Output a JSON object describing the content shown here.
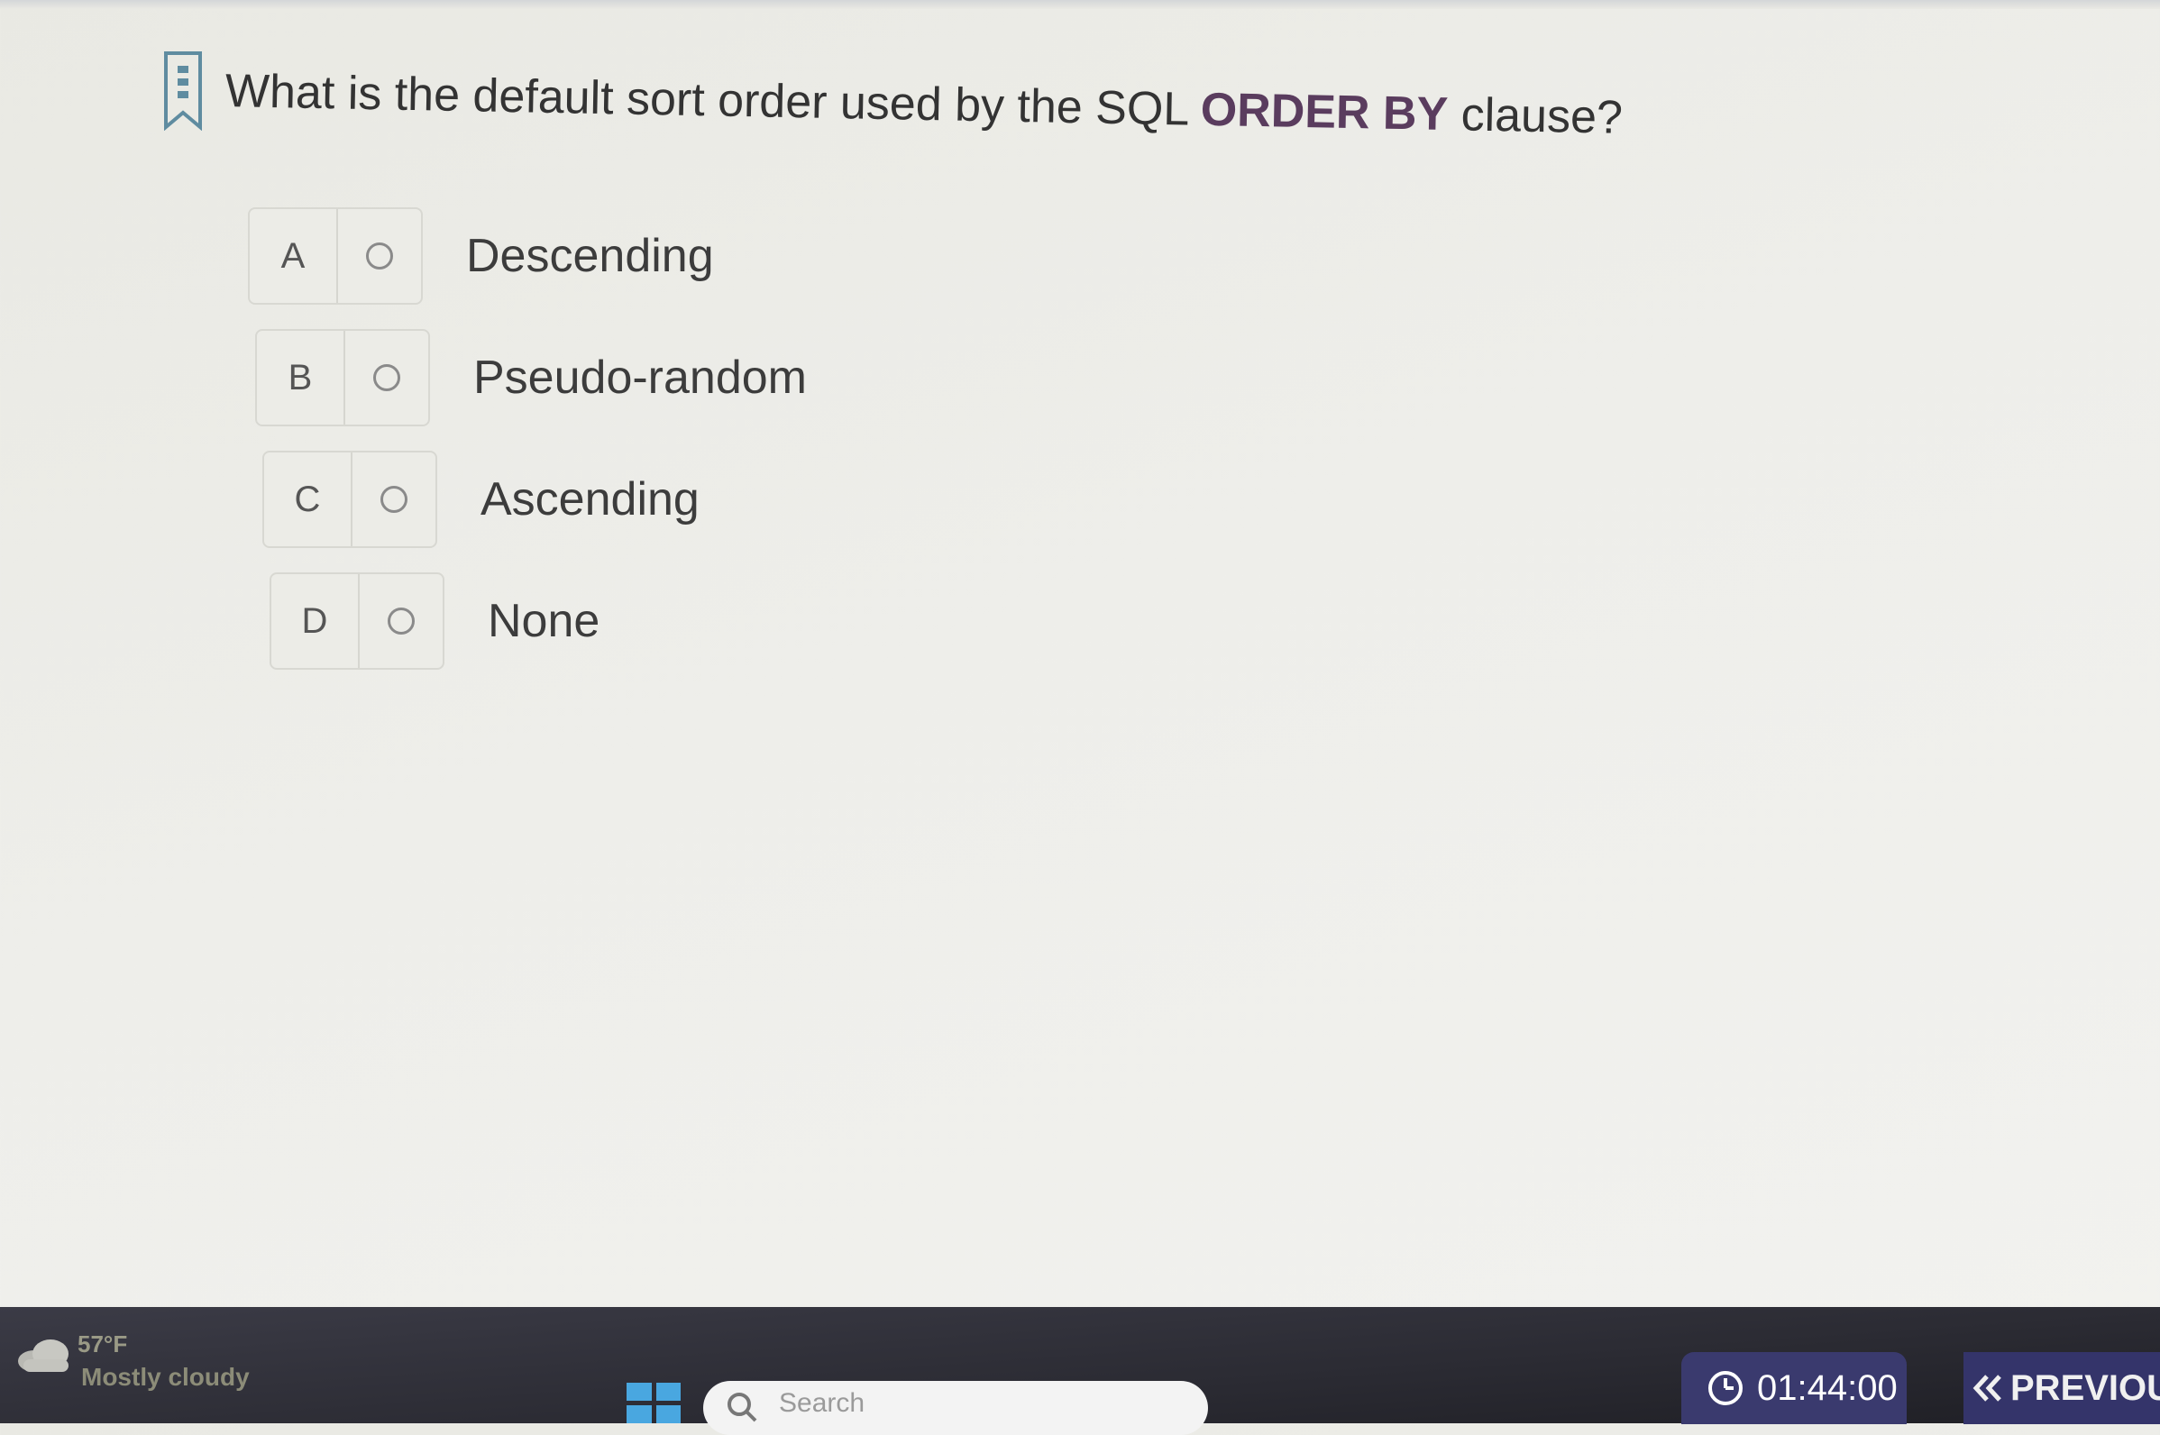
{
  "question": {
    "prefix": "What is the default sort order used by the SQL ",
    "keyword": "ORDER BY",
    "suffix": " clause?"
  },
  "options": [
    {
      "letter": "A",
      "text": "Descending"
    },
    {
      "letter": "B",
      "text": "Pseudo-random"
    },
    {
      "letter": "C",
      "text": "Ascending"
    },
    {
      "letter": "D",
      "text": "None"
    }
  ],
  "taskbar": {
    "weather": {
      "temp": "57°F",
      "description": "Mostly cloudy"
    },
    "search_placeholder": "Search"
  },
  "timer": {
    "value": "01:44:00"
  },
  "nav": {
    "previous_label": "PREVIOU"
  },
  "colors": {
    "keyword": "#5a3c5e",
    "timer_bg": "#3a3a6e",
    "taskbar_bg": "#2b2b33"
  }
}
